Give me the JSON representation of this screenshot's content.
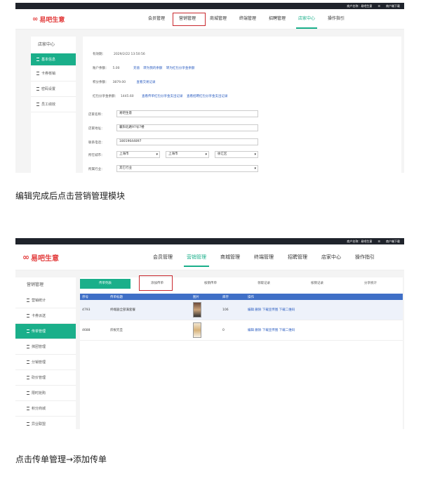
{
  "topbar": {
    "account": "商户名称：易吧生意",
    "download": "商户端下载",
    "menu_icon": "menu-icon"
  },
  "brand": {
    "name": "易吧生意",
    "color": "#e23a3a"
  },
  "nav": {
    "items": [
      "会员管理",
      "营销管理",
      "商城管理",
      "终端管理",
      "招聘管理",
      "店家中心",
      "操作指引"
    ]
  },
  "accent": "#1aaf8a",
  "screen1": {
    "side_title": "店家中心",
    "side_items": [
      "基本信息",
      "卡券核销",
      "密码设置",
      "员工绩效"
    ],
    "info": {
      "valid_label": "有效期：",
      "valid_value": "2029/2/22 13:50:56",
      "balance_label": "账户余额：",
      "balance_value": "5.00",
      "balance_links": [
        "充值",
        "转为我的余额",
        "转为红包分享金余额"
      ],
      "points_label": "积分余额：",
      "points_value": "3879.00",
      "points_link": "查看交易记录",
      "redpack_label": "红包分享金余额：",
      "redpack_value": "1445.60",
      "redpack_links": [
        "查看传单红包分享金支出记录",
        "查看招聘红包分享金支出记录"
      ]
    },
    "form": {
      "name_label": "店家名称：",
      "name_value": "易吧生意",
      "address_label": "店家地址：",
      "address_value": "襄阳北路97号7楼",
      "phone_label": "联系电话：",
      "phone_value": "18019644897",
      "city_label": "所在城市：",
      "province": "上海市",
      "city": "上海市",
      "district": "徐汇区",
      "industry_label": "所属行业：",
      "industry_value": "其它行业"
    }
  },
  "caption1": "编辑完成后点击营销管理模块",
  "screen2": {
    "side_title": "营销管理",
    "side_items": [
      "营销统计",
      "卡券派送",
      "传单管理",
      "抹团管理",
      "分销管理",
      "砍价管理",
      "限时抢购",
      "积分商城",
      "异业联盟"
    ],
    "tabs": [
      "传单列表",
      "添加传单",
      "核销传单",
      "领取记录",
      "核销记录",
      "分享统计"
    ],
    "table_headers": [
      "序号",
      "传单标题",
      "图片",
      "库存",
      "操作"
    ],
    "rows": [
      {
        "id": "4793",
        "title": "终端器全部满套餐",
        "stock": "106",
        "actions": "编辑 删除 下载宣传图 下载二维码"
      },
      {
        "id": "4688",
        "title": "庆祝元旦",
        "stock": "0",
        "actions": "编辑 删除 下载宣传图 下载二维码"
      }
    ]
  },
  "caption2": "点击传单管理→添加传单"
}
